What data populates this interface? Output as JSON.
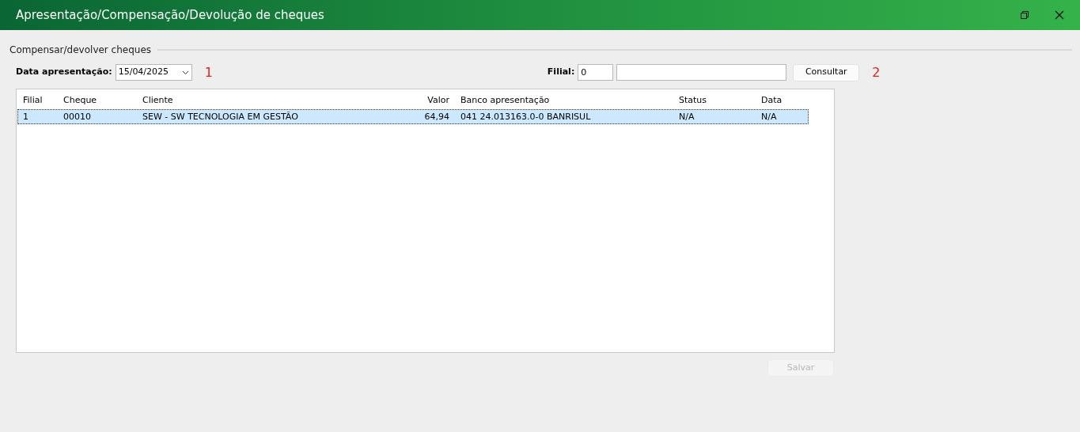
{
  "window": {
    "title": "Apresentação/Compensação/Devolução de cheques"
  },
  "group": {
    "title": "Compensar/devolver cheques"
  },
  "date_field": {
    "label": "Data apresentação:",
    "value": "15/04/2025"
  },
  "annotations": [
    "1",
    "2"
  ],
  "filial_field": {
    "label": "Filial:",
    "value": "0"
  },
  "consult_button": {
    "label": "Consultar",
    "disabled": false
  },
  "table": {
    "columns": [
      "Filial",
      "Cheque",
      "Cliente",
      "Valor",
      "Banco apresentação",
      "Status",
      "Data"
    ],
    "rows": [
      {
        "cells": [
          "1",
          "00010",
          "SEW - SW TECNOLOGIA EM GESTÃO",
          "64,94",
          "041 24.013163.0-0 BANRISUL",
          "N/A",
          "N/A"
        ],
        "selected": true
      }
    ]
  },
  "save_button": {
    "label": "Salvar",
    "disabled": true
  }
}
